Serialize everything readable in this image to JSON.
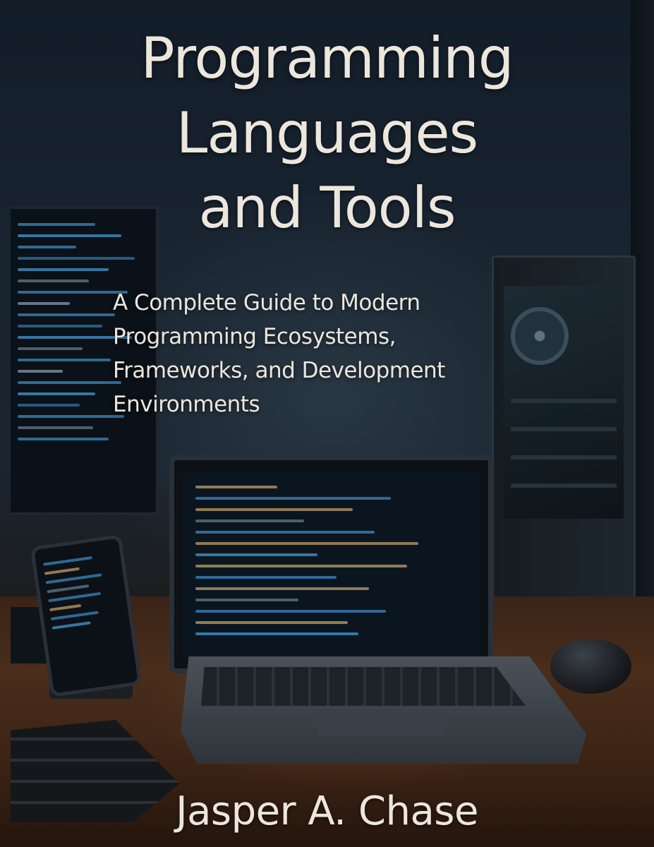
{
  "cover": {
    "title_lines": [
      "Programming",
      "Languages",
      "and Tools"
    ],
    "subtitle_lines": [
      "A Complete Guide to Modern",
      "Programming Ecosystems,",
      "Frameworks, and Development",
      "Environments"
    ],
    "author": "Jasper A. Chase"
  },
  "colors": {
    "text": "#ece6dc",
    "background": "#182430",
    "desk": "#4a2d1b",
    "code_accent": "#3f8fc9"
  }
}
